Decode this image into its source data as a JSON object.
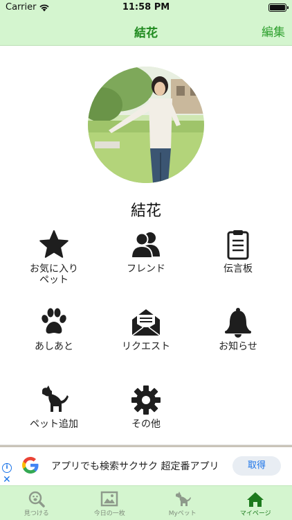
{
  "status_bar": {
    "carrier": "Carrier",
    "time": "11:58 PM"
  },
  "nav": {
    "title": "結花",
    "edit_label": "編集"
  },
  "profile": {
    "name": "結花"
  },
  "menu": {
    "favorites": "お気に入り\nペット",
    "friends": "フレンド",
    "message_board": "伝言板",
    "footprints": "あしあと",
    "requests": "リクエスト",
    "notifications": "お知らせ",
    "add_pet": "ペット追加",
    "other": "その他"
  },
  "ad": {
    "text": "アプリでも検索サクサク 超定番アプリ",
    "cta": "取得",
    "close": "✕",
    "info": "i"
  },
  "tabs": [
    {
      "label": "見つける",
      "icon": "magnifier-paw-icon"
    },
    {
      "label": "今日の一枚",
      "icon": "picture-icon"
    },
    {
      "label": "Myペット",
      "icon": "dog-icon"
    },
    {
      "label": "マイページ",
      "icon": "home-icon"
    }
  ],
  "colors": {
    "bar_green": "#d4f5cf",
    "title_green": "#1f8a1f",
    "tab_active": "#1d7a1d",
    "ad_blue": "#1a73e8"
  }
}
